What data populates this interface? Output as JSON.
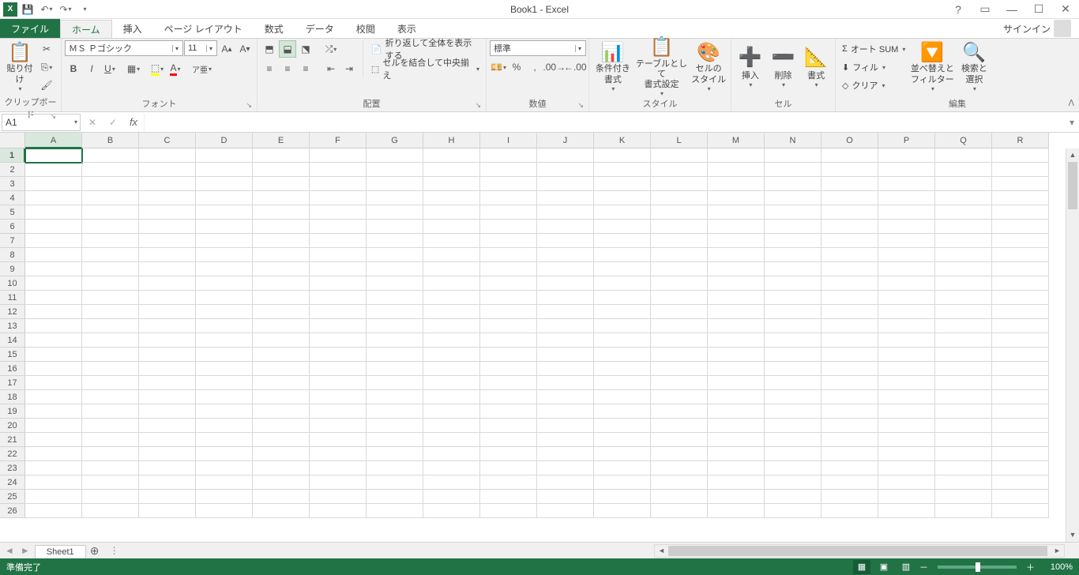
{
  "title": "Book1 - Excel",
  "signin": "サインイン",
  "tabs": {
    "file": "ファイル",
    "home": "ホーム",
    "insert": "挿入",
    "pagelayout": "ページ レイアウト",
    "formulas": "数式",
    "data": "データ",
    "review": "校閲",
    "view": "表示"
  },
  "groups": {
    "clipboard": {
      "label": "クリップボード",
      "paste": "貼り付け"
    },
    "font": {
      "label": "フォント",
      "name": "ＭＳ Ｐゴシック",
      "size": "11"
    },
    "alignment": {
      "label": "配置",
      "wrap": "折り返して全体を表示する",
      "merge": "セルを結合して中央揃え"
    },
    "number": {
      "label": "数値",
      "format": "標準"
    },
    "styles": {
      "label": "スタイル",
      "cond": "条件付き\n書式",
      "table": "テーブルとして\n書式設定",
      "cell": "セルの\nスタイル"
    },
    "cells": {
      "label": "セル",
      "insert": "挿入",
      "delete": "削除",
      "format": "書式"
    },
    "editing": {
      "label": "編集",
      "autosum": "オート SUM",
      "fill": "フィル",
      "clear": "クリア",
      "sort": "並べ替えと\nフィルター",
      "find": "検索と\n選択"
    }
  },
  "namebox": "A1",
  "columns": [
    "A",
    "B",
    "C",
    "D",
    "E",
    "F",
    "G",
    "H",
    "I",
    "J",
    "K",
    "L",
    "M",
    "N",
    "O",
    "P",
    "Q",
    "R"
  ],
  "rowcount": 26,
  "sheet": "Sheet1",
  "status": "準備完了",
  "zoom": "100%"
}
